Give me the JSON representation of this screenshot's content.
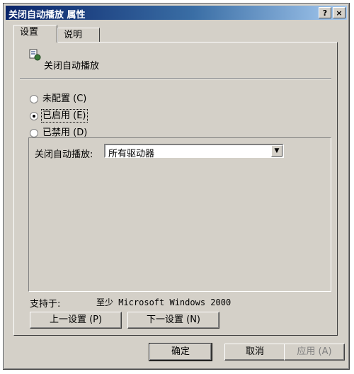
{
  "window": {
    "title": "关闭自动播放 属性",
    "help_button": "?",
    "close_button": "×"
  },
  "tabs": [
    {
      "label": "设置"
    },
    {
      "label": "说明"
    }
  ],
  "policy": {
    "name": "关闭自动播放",
    "icon": "policy-setting-icon"
  },
  "radios": [
    {
      "label": "未配置 (C)",
      "checked": false
    },
    {
      "label": "已启用 (E)",
      "checked": true
    },
    {
      "label": "已禁用 (D)",
      "checked": false
    }
  ],
  "option": {
    "label": "关闭自动播放:",
    "value": "所有驱动器"
  },
  "supported": {
    "label": "支持于:",
    "value": "至少 Microsoft Windows 2000"
  },
  "nav": {
    "prev": "上一设置 (P)",
    "next": "下一设置 (N)"
  },
  "footer": {
    "ok": "确定",
    "cancel": "取消",
    "apply": "应用 (A)"
  }
}
